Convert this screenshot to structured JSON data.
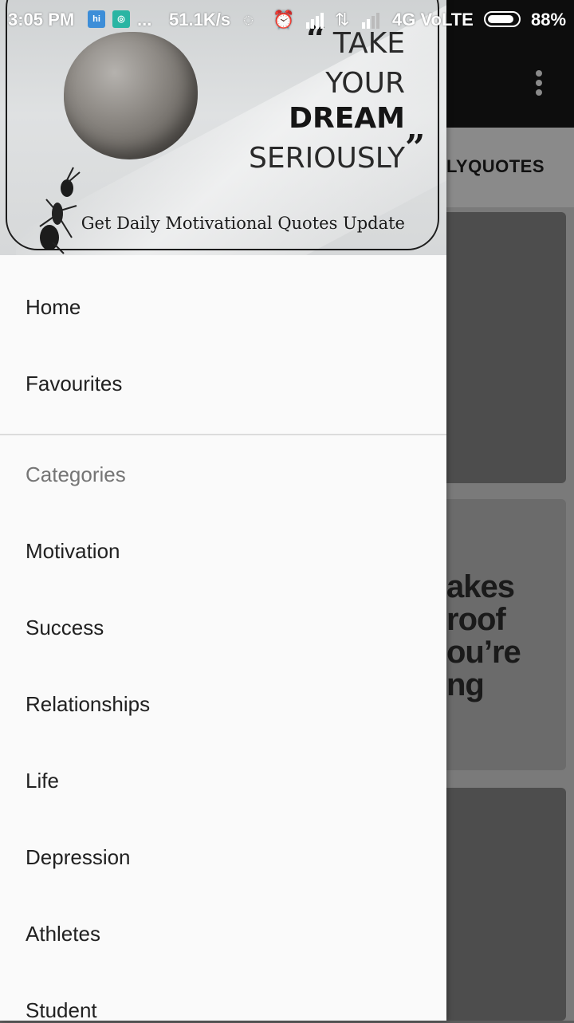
{
  "status_bar": {
    "time": "3:05 PM",
    "notification_dots": "...",
    "network_speed": "51.1K/s",
    "network_type": "4G VoLTE",
    "battery": "88%",
    "icons": [
      "hike-icon",
      "vpn-icon",
      "hotspot-icon",
      "alarm-icon",
      "signal-icon",
      "data-arrows-icon",
      "signal-icon-2",
      "battery-icon"
    ],
    "battery_level": 0.88
  },
  "app": {
    "tab_partial_label": "LYQUOTES",
    "card_partial_text": "akes\nroof\nou’re\nng"
  },
  "drawer": {
    "header": {
      "quote_line1": "TAKE",
      "quote_line2": "YOUR",
      "quote_line3": "DREAM",
      "quote_line4": "SERIOUSLY",
      "tagline": "Get Daily Motivational Quotes Update"
    },
    "primary_items": [
      {
        "label": "Home"
      },
      {
        "label": "Favourites"
      }
    ],
    "section_title": "Categories",
    "categories": [
      {
        "label": "Motivation"
      },
      {
        "label": "Success"
      },
      {
        "label": "Relationships"
      },
      {
        "label": "Life"
      },
      {
        "label": "Depression"
      },
      {
        "label": "Athletes"
      },
      {
        "label": "Student"
      }
    ]
  },
  "colors": {
    "drawer_bg": "#fafafa",
    "toolbar_bg": "#0d0d0d",
    "text_primary": "#212121",
    "text_secondary": "#757575"
  }
}
